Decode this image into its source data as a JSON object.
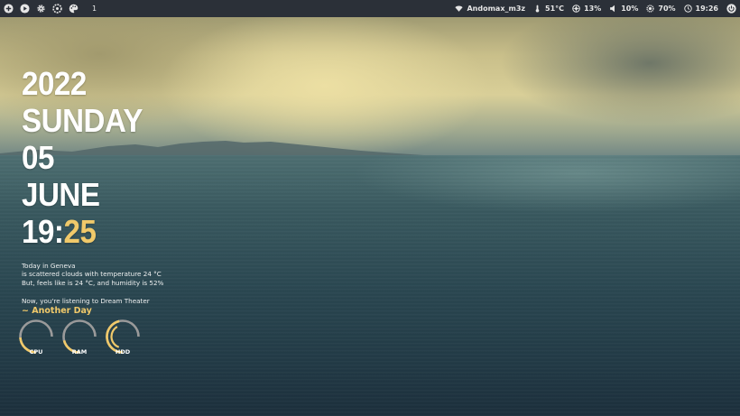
{
  "topbar": {
    "left_icons": [
      "add-icon",
      "play-icon",
      "gear-icon",
      "settings-icon",
      "palette-icon"
    ],
    "workspace": "1",
    "wifi_icon": "wifi-icon",
    "network_name": "Andomax_m3z",
    "temperature": "51°C",
    "cpu_percent": "13%",
    "volume": "10%",
    "brightness": "70%",
    "clock": "19:26",
    "power_icon": "power-icon"
  },
  "conky": {
    "year": "2022",
    "weekday": "SUNDAY",
    "day": "05",
    "month": "JUNE",
    "time_hour": "19:",
    "time_minute": "25",
    "weather_line1": "Today in Geneva",
    "weather_line2": "is scattered clouds with temperature 24 °C",
    "weather_line3": "But, feels like is 24 °C, and humidity is 52%",
    "music_line": "Now, you're listening to Dream Theater",
    "song": "~ Another Day"
  },
  "gauges": [
    {
      "label": "CPU",
      "fraction": 0.32
    },
    {
      "label": "RAM",
      "fraction": 0.28
    },
    {
      "label": "HDD",
      "fraction": 0.62
    }
  ],
  "colors": {
    "accent": "#f0c96a",
    "panel": "#2b3038",
    "gauge_track": "#9a9a9a"
  }
}
